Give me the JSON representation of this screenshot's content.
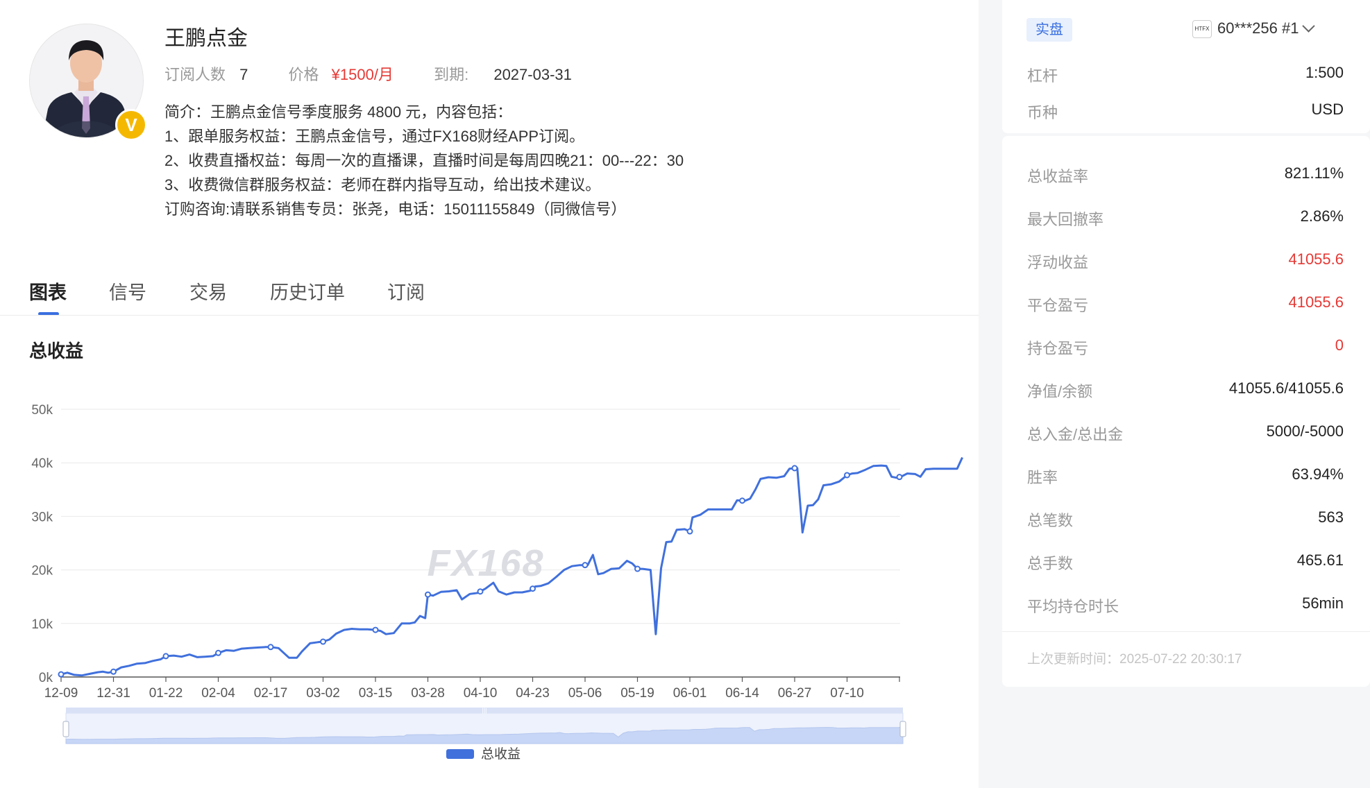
{
  "profile": {
    "name": "王鹏点金",
    "subscribers_label": "订阅人数",
    "subscribers": "7",
    "price_label": "价格",
    "price": "¥1500/月",
    "expire_label": "到期:",
    "expire": "2027-03-31",
    "badge": "V",
    "description": [
      "简介：王鹏点金信号季度服务 4800 元，内容包括：",
      "1、跟单服务权益：王鹏点金信号，通过FX168财经APP订阅。",
      "2、收费直播权益：每周一次的直播课，直播时间是每周四晚21：00---22：30",
      "3、收费微信群服务权益：老师在群内指导互动，给出技术建议。",
      "订购咨询:请联系销售专员：张尧，电话：15011155849（同微信号）"
    ]
  },
  "tabs": [
    "图表",
    "信号",
    "交易",
    "历史订单",
    "订阅"
  ],
  "active_tab": "图表",
  "chart_title": "总收益",
  "chart_data": {
    "type": "line",
    "title": "总收益",
    "watermark": "FX168",
    "x_ticks": [
      "12-09",
      "12-31",
      "01-22",
      "02-04",
      "02-17",
      "03-02",
      "03-15",
      "03-28",
      "04-10",
      "04-23",
      "05-06",
      "05-19",
      "06-01",
      "06-14",
      "06-27",
      "07-10"
    ],
    "y_ticks": [
      "0k",
      "10k",
      "20k",
      "30k",
      "40k",
      "50k"
    ],
    "ylim": [
      0,
      50000
    ],
    "legend": "总收益",
    "legend_position": "bottom",
    "color": "#4070dc",
    "series": [
      {
        "name": "总收益",
        "points": [
          [
            0.0,
            500
          ],
          [
            0.12,
            800
          ],
          [
            0.25,
            400
          ],
          [
            0.4,
            300
          ],
          [
            0.55,
            600
          ],
          [
            0.7,
            900
          ],
          [
            0.8,
            1000
          ],
          [
            0.9,
            800
          ],
          [
            1.0,
            1000
          ],
          [
            1.15,
            1800
          ],
          [
            1.3,
            2100
          ],
          [
            1.45,
            2500
          ],
          [
            1.6,
            2600
          ],
          [
            1.75,
            3000
          ],
          [
            1.9,
            3300
          ],
          [
            2.0,
            3900
          ],
          [
            2.15,
            4000
          ],
          [
            2.3,
            3800
          ],
          [
            2.45,
            4200
          ],
          [
            2.6,
            3700
          ],
          [
            2.75,
            3800
          ],
          [
            2.9,
            3900
          ],
          [
            3.0,
            4500
          ],
          [
            3.15,
            5000
          ],
          [
            3.3,
            4900
          ],
          [
            3.45,
            5300
          ],
          [
            3.6,
            5400
          ],
          [
            3.75,
            5500
          ],
          [
            3.9,
            5600
          ],
          [
            4.0,
            5600
          ],
          [
            4.15,
            5400
          ],
          [
            4.25,
            4500
          ],
          [
            4.35,
            3600
          ],
          [
            4.5,
            3600
          ],
          [
            4.6,
            4800
          ],
          [
            4.75,
            6300
          ],
          [
            4.9,
            6500
          ],
          [
            5.0,
            6600
          ],
          [
            5.12,
            7000
          ],
          [
            5.25,
            8100
          ],
          [
            5.4,
            8800
          ],
          [
            5.55,
            9000
          ],
          [
            5.7,
            8900
          ],
          [
            5.85,
            8900
          ],
          [
            6.0,
            8800
          ],
          [
            6.1,
            8600
          ],
          [
            6.2,
            8000
          ],
          [
            6.35,
            8200
          ],
          [
            6.5,
            10000
          ],
          [
            6.65,
            10000
          ],
          [
            6.75,
            10200
          ],
          [
            6.85,
            11400
          ],
          [
            6.95,
            11000
          ],
          [
            7.0,
            15400
          ],
          [
            7.1,
            15200
          ],
          [
            7.25,
            15900
          ],
          [
            7.4,
            16000
          ],
          [
            7.55,
            16200
          ],
          [
            7.65,
            14500
          ],
          [
            7.8,
            15500
          ],
          [
            7.95,
            15700
          ],
          [
            8.1,
            16500
          ],
          [
            8.25,
            17600
          ],
          [
            8.35,
            16000
          ],
          [
            8.5,
            15400
          ],
          [
            8.65,
            15800
          ],
          [
            8.8,
            15800
          ],
          [
            8.95,
            16100
          ],
          [
            9.05,
            16900
          ],
          [
            9.15,
            17000
          ],
          [
            9.3,
            17500
          ],
          [
            9.45,
            18700
          ],
          [
            9.6,
            20000
          ],
          [
            9.75,
            20700
          ],
          [
            9.9,
            20900
          ],
          [
            10.05,
            20900
          ],
          [
            10.15,
            22800
          ],
          [
            10.25,
            19200
          ],
          [
            10.35,
            19400
          ],
          [
            10.5,
            20200
          ],
          [
            10.65,
            20300
          ],
          [
            10.8,
            21700
          ],
          [
            10.9,
            21200
          ],
          [
            11.0,
            20200
          ],
          [
            11.1,
            20200
          ],
          [
            11.25,
            20000
          ],
          [
            11.35,
            8000
          ],
          [
            11.45,
            20300
          ],
          [
            11.55,
            25200
          ],
          [
            11.65,
            25300
          ],
          [
            11.75,
            27500
          ],
          [
            11.9,
            27600
          ],
          [
            12.0,
            27200
          ],
          [
            12.05,
            29800
          ],
          [
            12.2,
            30300
          ],
          [
            12.35,
            31300
          ],
          [
            12.5,
            31300
          ],
          [
            12.65,
            31300
          ],
          [
            12.8,
            31300
          ],
          [
            12.9,
            33000
          ],
          [
            13.05,
            32900
          ],
          [
            13.15,
            33300
          ],
          [
            13.25,
            35000
          ],
          [
            13.35,
            37000
          ],
          [
            13.5,
            37300
          ],
          [
            13.65,
            37200
          ],
          [
            13.8,
            37500
          ],
          [
            13.9,
            38900
          ],
          [
            14.0,
            39000
          ],
          [
            14.05,
            39000
          ],
          [
            14.15,
            27000
          ],
          [
            14.25,
            32000
          ],
          [
            14.35,
            32100
          ],
          [
            14.45,
            33200
          ],
          [
            14.55,
            35800
          ],
          [
            14.7,
            36000
          ],
          [
            14.85,
            36500
          ],
          [
            15.0,
            37700
          ],
          [
            15.1,
            38000
          ],
          [
            15.2,
            38100
          ],
          [
            15.35,
            38700
          ],
          [
            15.5,
            39400
          ],
          [
            15.65,
            39500
          ],
          [
            15.75,
            39400
          ],
          [
            15.85,
            37400
          ],
          [
            15.95,
            37200
          ],
          [
            16.05,
            37500
          ],
          [
            16.15,
            38000
          ],
          [
            16.3,
            37900
          ],
          [
            16.4,
            37400
          ],
          [
            16.5,
            38800
          ],
          [
            16.65,
            38900
          ],
          [
            16.8,
            38900
          ],
          [
            16.95,
            38900
          ],
          [
            17.1,
            38900
          ],
          [
            17.2,
            41000
          ]
        ],
        "markers_at": [
          0.0,
          1.0,
          2.0,
          3.0,
          4.0,
          5.0,
          6.0,
          7.0,
          8.0,
          9.0,
          10.0,
          11.0,
          12.0,
          13.0,
          14.0,
          15.0,
          16.0
        ]
      }
    ],
    "zoom_slider": "full range"
  },
  "account": {
    "tag": "实盘",
    "broker_logo_text": "HTFX",
    "account_id": "60***256 #1",
    "rows_top": [
      {
        "label": "杠杆",
        "value": "1:500"
      },
      {
        "label": "币种",
        "value": "USD"
      }
    ],
    "stats": [
      {
        "label": "总收益率",
        "value": "821.11%",
        "color": "dark"
      },
      {
        "label": "最大回撤率",
        "value": "2.86%",
        "color": "dark"
      },
      {
        "label": "浮动收益",
        "value": "41055.6",
        "color": "red"
      },
      {
        "label": "平仓盈亏",
        "value": "41055.6",
        "color": "red"
      },
      {
        "label": "持仓盈亏",
        "value": "0",
        "color": "red"
      },
      {
        "label": "净值/余额",
        "value": "41055.6/41055.6",
        "color": "dark"
      },
      {
        "label": "总入金/总出金",
        "value": "5000/-5000",
        "color": "dark"
      },
      {
        "label": "胜率",
        "value": "63.94%",
        "color": "dark"
      },
      {
        "label": "总笔数",
        "value": "563",
        "color": "dark"
      },
      {
        "label": "总手数",
        "value": "465.61",
        "color": "dark"
      },
      {
        "label": "平均持仓时长",
        "value": "56min",
        "color": "dark"
      }
    ],
    "updated": "上次更新时间：2025-07-22 20:30:17"
  },
  "colors": {
    "accent": "#3a6fe0",
    "red": "#e53935",
    "badge": "#f5b800"
  }
}
